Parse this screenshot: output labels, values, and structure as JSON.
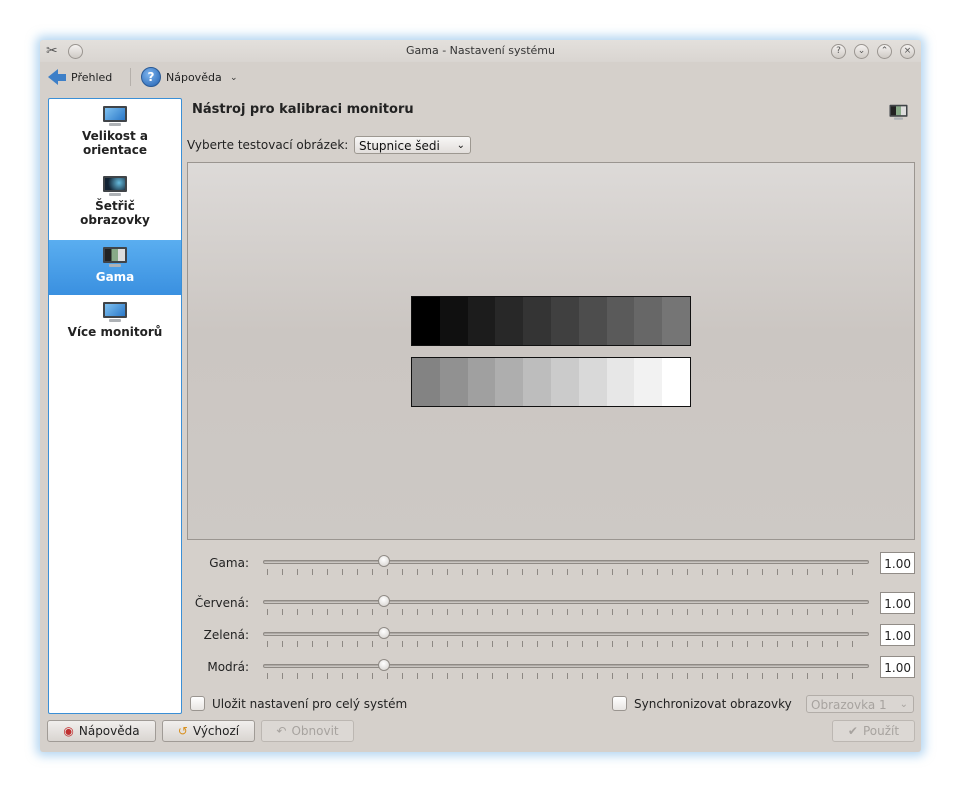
{
  "window": {
    "title": "Gama - Nastavení systému"
  },
  "toolbar": {
    "overview_label": "Přehled",
    "help_label": "Nápověda"
  },
  "sidebar": {
    "items": [
      {
        "label_line1": "Velikost a",
        "label_line2": "orientace",
        "icon": "monitor-icon"
      },
      {
        "label_line1": "Šetřič",
        "label_line2": "obrazovky",
        "icon": "screensaver-icon"
      },
      {
        "label_line1": "Gama",
        "label_line2": "",
        "icon": "gamma-monitor-icon",
        "active": true
      },
      {
        "label_line1": "Více monitorů",
        "label_line2": "",
        "icon": "monitor-icon"
      }
    ]
  },
  "main": {
    "heading": "Nástroj pro kalibraci monitoru",
    "test_image_label": "Vyberte testovací obrázek:",
    "test_image_value": "Stupnice šedi",
    "grayscale_top": [
      "#000000",
      "#101010",
      "#1c1c1c",
      "#282828",
      "#343434",
      "#404040",
      "#4d4d4d",
      "#5a5a5a",
      "#676767",
      "#757575"
    ],
    "grayscale_bottom": [
      "#838383",
      "#919191",
      "#a0a0a0",
      "#aeaeae",
      "#bdbdbd",
      "#cbcbcb",
      "#d9d9d9",
      "#e7e7e7",
      "#f2f2f2",
      "#ffffff"
    ]
  },
  "sliders": [
    {
      "label": "Gama:",
      "value": "1.00",
      "fraction": 0.2
    },
    {
      "label": "Červená:",
      "value": "1.00",
      "fraction": 0.2
    },
    {
      "label": "Zelená:",
      "value": "1.00",
      "fraction": 0.2
    },
    {
      "label": "Modrá:",
      "value": "1.00",
      "fraction": 0.2
    }
  ],
  "options": {
    "save_system_label": "Uložit nastavení pro celý systém",
    "sync_label": "Synchronizovat obrazovky",
    "screen_select": "Obrazovka 1"
  },
  "buttons": {
    "help": "Nápověda",
    "defaults": "Výchozí",
    "reset": "Obnovit",
    "apply": "Použít"
  }
}
